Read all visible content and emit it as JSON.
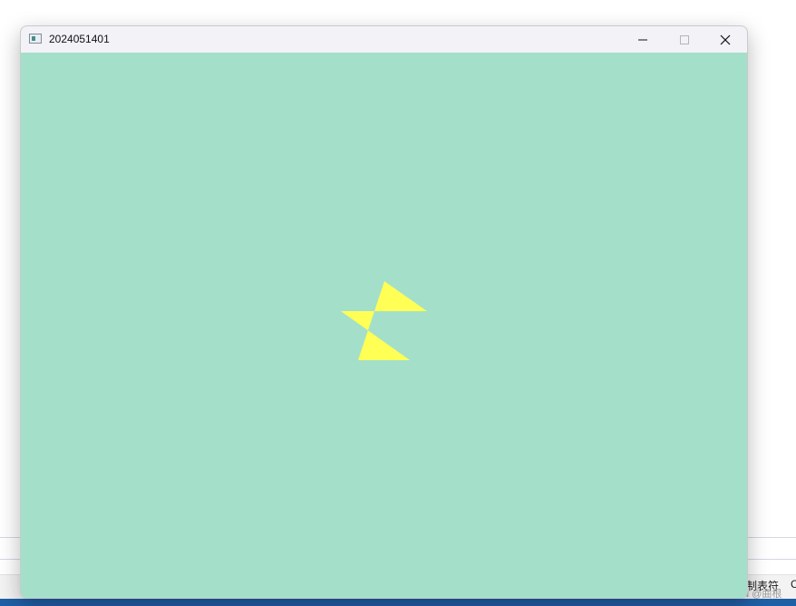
{
  "window": {
    "title": "2024051401",
    "background_color": "#a4e0c9",
    "icon": "app-window-icon",
    "controls": {
      "minimize_icon": "minimize-icon",
      "maximize_icon": "maximize-icon",
      "close_icon": "close-icon"
    }
  },
  "canvas": {
    "shape": "five-pointed-star",
    "fill_color": "#ffff55"
  },
  "background_app": {
    "status_text": "制表符",
    "status_text_extra": "C"
  },
  "watermark": {
    "text": "CSDN @曲根"
  }
}
